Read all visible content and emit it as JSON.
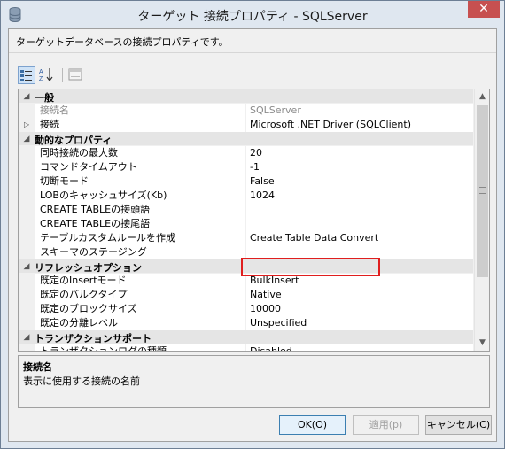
{
  "window": {
    "title": "ターゲット 接続プロパティ - SQLServer",
    "close_glyph": "✕",
    "description": "ターゲットデータベースの接続プロパティです。"
  },
  "toolbar": {
    "categorized_icon": "categorized-view-icon",
    "alphabetical_icon": "alphabetical-sort-icon",
    "property_pages_icon": "property-pages-icon"
  },
  "grid": {
    "rows": [
      {
        "kind": "cat",
        "name": "一般",
        "toggle": "◢"
      },
      {
        "kind": "prop",
        "name": "接続名",
        "value": "SQLServer",
        "gray": true
      },
      {
        "kind": "prop",
        "name": "接続",
        "value": "Microsoft .NET Driver (SQLClient)",
        "expander": "▷"
      },
      {
        "kind": "cat",
        "name": "動的なプロパティ",
        "toggle": "◢"
      },
      {
        "kind": "prop",
        "name": "同時接続の最大数",
        "value": "20"
      },
      {
        "kind": "prop",
        "name": "コマンドタイムアウト",
        "value": "-1"
      },
      {
        "kind": "prop",
        "name": "切断モード",
        "value": "False"
      },
      {
        "kind": "prop",
        "name": "LOBのキャッシュサイズ(Kb)",
        "value": "1024"
      },
      {
        "kind": "prop",
        "name": "CREATE TABLEの接頭語",
        "value": ""
      },
      {
        "kind": "prop",
        "name": "CREATE TABLEの接尾語",
        "value": ""
      },
      {
        "kind": "prop",
        "name": "テーブルカスタムルールを作成",
        "value": "Create Table Data Convert"
      },
      {
        "kind": "prop",
        "name": "スキーマのステージング",
        "value": ""
      },
      {
        "kind": "cat",
        "name": "リフレッシュオプション",
        "toggle": "◢"
      },
      {
        "kind": "prop",
        "name": "既定のInsertモード",
        "value": "BulkInsert"
      },
      {
        "kind": "prop",
        "name": "既定のバルクタイプ",
        "value": "Native"
      },
      {
        "kind": "prop",
        "name": "既定のブロックサイズ",
        "value": "10000"
      },
      {
        "kind": "prop",
        "name": "既定の分離レベル",
        "value": "Unspecified"
      },
      {
        "kind": "cat",
        "name": "トランザクションサポート",
        "toggle": "◢"
      },
      {
        "kind": "prop",
        "name": "トランザクションログの種類",
        "value": "Disabled"
      }
    ],
    "scroll_up": "▲",
    "scroll_down": "▼"
  },
  "help": {
    "title": "接続名",
    "text": "表示に使用する接続の名前"
  },
  "buttons": {
    "ok": "OK(O)",
    "apply": "適用(p)",
    "cancel": "キャンセル(C)"
  }
}
